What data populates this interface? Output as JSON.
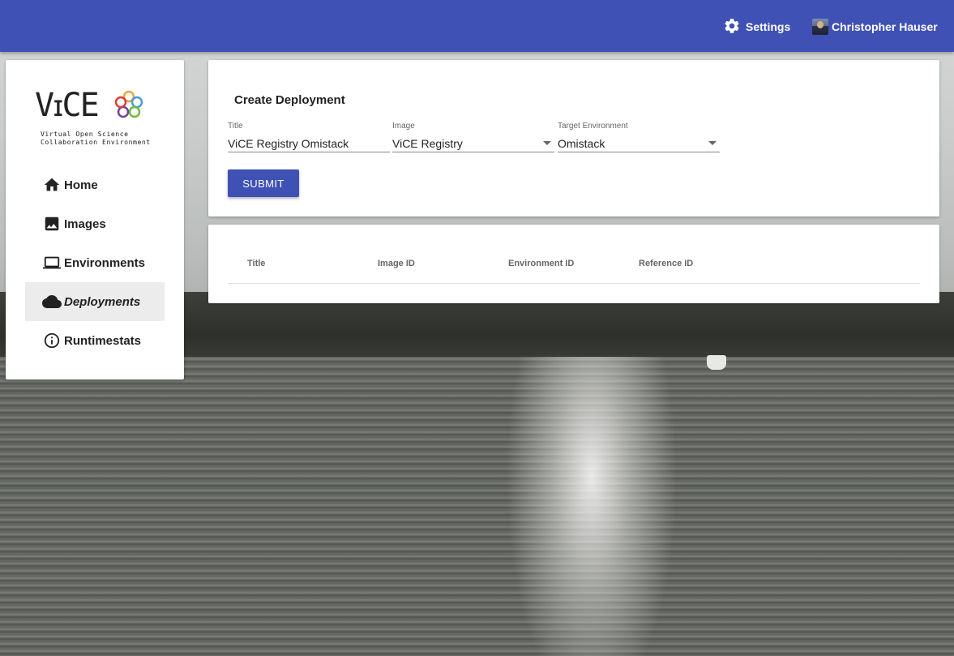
{
  "header": {
    "settings_label": "Settings",
    "user_name": "Christopher Hauser"
  },
  "logo": {
    "wordmark": "VICE",
    "subtitle_line1": "Virtual Open Science",
    "subtitle_line2": "Collaboration Environment"
  },
  "sidebar": {
    "items": [
      {
        "label": "Home",
        "icon": "home-icon"
      },
      {
        "label": "Images",
        "icon": "image-icon"
      },
      {
        "label": "Environments",
        "icon": "laptop-icon"
      },
      {
        "label": "Deployments",
        "icon": "cloud-icon",
        "active": true
      },
      {
        "label": "Runtimestats",
        "icon": "info-icon"
      }
    ]
  },
  "form": {
    "title": "Create Deployment",
    "fields": [
      {
        "label": "Title",
        "value": "ViCE Registry Omistack"
      },
      {
        "label": "Image",
        "value": "ViCE Registry"
      },
      {
        "label": "Target Environment",
        "value": "Omistack"
      }
    ],
    "submit_label": "SUBMIT"
  },
  "table": {
    "columns": [
      "Title",
      "Image ID",
      "Environment ID",
      "Reference ID"
    ],
    "rows": []
  },
  "colors": {
    "primary": "#3f51b5",
    "active_item_bg": "#ececec"
  }
}
